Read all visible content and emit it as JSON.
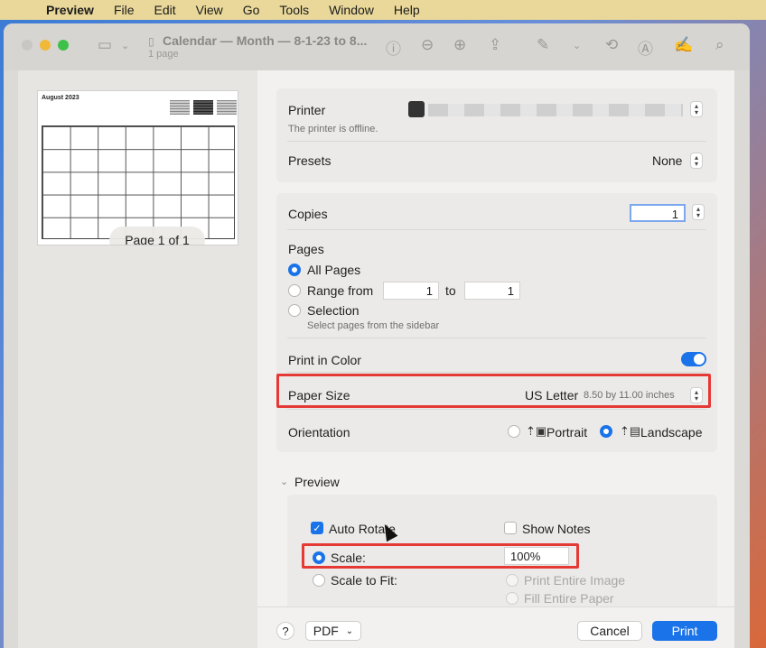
{
  "menubar": {
    "app": "Preview",
    "items": [
      "File",
      "Edit",
      "View",
      "Go",
      "Tools",
      "Window",
      "Help"
    ]
  },
  "window": {
    "title": "Calendar — Month — 8-1-23 to 8...",
    "subtitle": "1 page"
  },
  "sidebar": {
    "thumbnail_title": "August 2023",
    "page_indicator": "Page 1 of 1"
  },
  "printer": {
    "label": "Printer",
    "status": "The printer is offline.",
    "presets_label": "Presets",
    "presets_value": "None"
  },
  "copies": {
    "label": "Copies",
    "value": "1"
  },
  "pages": {
    "label": "Pages",
    "all_pages": "All Pages",
    "range_from": "Range from",
    "range_start": "1",
    "range_to": "to",
    "range_end": "1",
    "selection": "Selection",
    "selection_hint": "Select pages from the sidebar"
  },
  "color": {
    "label": "Print in Color",
    "enabled": true
  },
  "paper": {
    "label": "Paper Size",
    "value": "US Letter",
    "detail": "8.50 by 11.00 inches"
  },
  "orientation": {
    "label": "Orientation",
    "portrait": "Portrait",
    "landscape": "Landscape",
    "selected": "Landscape"
  },
  "preview": {
    "section_label": "Preview",
    "auto_rotate": "Auto Rotate",
    "show_notes": "Show Notes",
    "scale_label": "Scale:",
    "scale_value": "100%",
    "scale_to_fit": "Scale to Fit:",
    "print_entire_image": "Print Entire Image",
    "fill_entire_paper": "Fill Entire Paper"
  },
  "footer": {
    "help": "?",
    "pdf": "PDF",
    "cancel": "Cancel",
    "print": "Print"
  },
  "colors": {
    "accent": "#1a73e8",
    "highlight": "#e53935"
  }
}
